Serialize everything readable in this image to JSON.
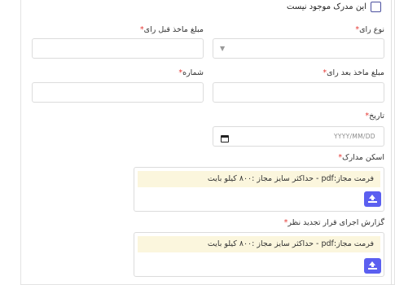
{
  "checkbox": {
    "label": "این مدرک موجود نیست",
    "checked": false
  },
  "fields": {
    "vote_type": {
      "label": "نوع رای",
      "required_mark": "*"
    },
    "amount_before": {
      "label": "مبلغ ماخذ قبل رای",
      "required_mark": "*"
    },
    "amount_after": {
      "label": "مبلغ ماخذ بعد رای",
      "required_mark": "*"
    },
    "number": {
      "label": "شماره",
      "required_mark": "*"
    },
    "date": {
      "label": "تاریخ",
      "required_mark": "*",
      "placeholder": "YYYY/MM/DD"
    }
  },
  "uploads": {
    "scan": {
      "label": "اسکن مدارک",
      "required_mark": "*",
      "notice": "فرمت مجاز:pdf - حداکثر سایز مجاز :۸۰۰ کیلو بایت"
    },
    "report": {
      "label": "گزارش اجرای قرار تجدید نظر",
      "required_mark": "*",
      "notice": "فرمت مجاز:pdf - حداکثر سایز مجاز :۸۰۰ کیلو بایت"
    }
  },
  "icons": {
    "select_arrow": "chevron-down-icon",
    "calendar": "calendar-icon",
    "upload": "upload-icon"
  },
  "colors": {
    "accent": "#5b5ff0",
    "required": "#e53935",
    "notice_bg": "#fbf6dd",
    "checkbox_border": "#4a4f9e"
  }
}
